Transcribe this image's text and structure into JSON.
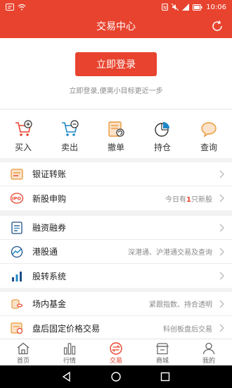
{
  "statusbar": {
    "time": "10:06"
  },
  "header": {
    "title": "交易中心"
  },
  "login": {
    "button_label": "立即登录",
    "tip": "立即登录,便离小目标更近一步"
  },
  "quick_actions": [
    {
      "label": "买入",
      "icon": "cart-plus-icon"
    },
    {
      "label": "卖出",
      "icon": "cart-minus-icon"
    },
    {
      "label": "撤单",
      "icon": "cancel-order-icon"
    },
    {
      "label": "持仓",
      "icon": "pie-chart-icon"
    },
    {
      "label": "查询",
      "icon": "chat-bubble-icon"
    }
  ],
  "menu": {
    "transfer": {
      "label": "银证转账"
    },
    "ipo": {
      "label": "新股申购",
      "sub_prefix": "今日有",
      "sub_count": "1",
      "sub_suffix": "只新股"
    },
    "margin": {
      "label": "融资融券"
    },
    "hk": {
      "label": "港股通",
      "sub": "深港通、沪港通交易及查询"
    },
    "transfer_system": {
      "label": "股转系统"
    },
    "fund": {
      "label": "场内基金",
      "sub": "紧跟指数、持合透明"
    },
    "after_hours": {
      "label": "盘后固定价格交易",
      "sub": "科创板盘后交易"
    }
  },
  "tabs": [
    {
      "label": "首页",
      "icon": "home-icon"
    },
    {
      "label": "行情",
      "icon": "bar-chart-icon"
    },
    {
      "label": "交易",
      "icon": "trade-icon"
    },
    {
      "label": "商城",
      "icon": "store-icon"
    },
    {
      "label": "我的",
      "icon": "user-icon"
    }
  ],
  "colors": {
    "accent": "#e8432e",
    "background": "#f2f2f2"
  }
}
